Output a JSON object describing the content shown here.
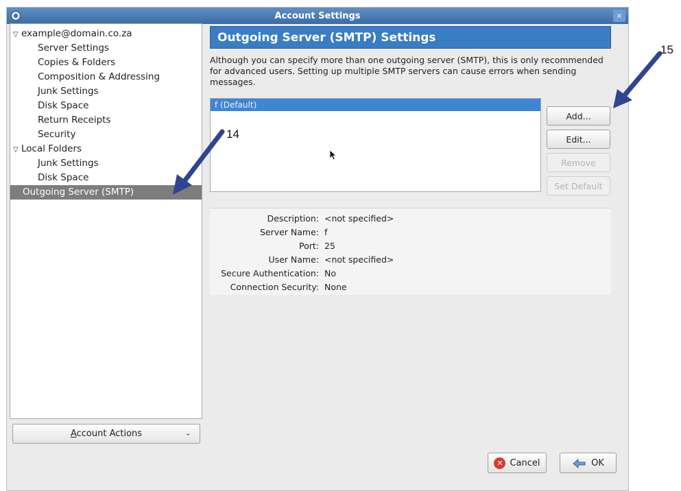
{
  "dialog": {
    "title": "Account Settings",
    "close_glyph": "✕",
    "icon": "app-icon"
  },
  "tree": {
    "items": [
      {
        "label": "example@domain.co.za",
        "twisty": "▽"
      },
      {
        "label": "Server Settings"
      },
      {
        "label": "Copies & Folders"
      },
      {
        "label": "Composition & Addressing"
      },
      {
        "label": "Junk Settings"
      },
      {
        "label": "Disk Space"
      },
      {
        "label": "Return Receipts"
      },
      {
        "label": "Security"
      },
      {
        "label": "Local Folders",
        "twisty": "▽"
      },
      {
        "label": "Junk Settings"
      },
      {
        "label": "Disk Space"
      },
      {
        "label": "Outgoing Server (SMTP)",
        "selected": true
      }
    ]
  },
  "account_actions": {
    "label": "Account Actions",
    "chevron": "⌄"
  },
  "panel": {
    "title": "Outgoing Server (SMTP) Settings",
    "description": "Although you can specify more than one outgoing server (SMTP), this is only recommended for advanced users. Setting up multiple SMTP servers can cause errors when sending messages."
  },
  "server_list": {
    "items": [
      "f (Default)"
    ]
  },
  "buttons": {
    "add": "Add...",
    "edit": "Edit...",
    "remove": "Remove",
    "set_default": "Set Default"
  },
  "details": {
    "rows": [
      {
        "key": "Description:",
        "value": "<not specified>"
      },
      {
        "key": "Server Name:",
        "value": "f"
      },
      {
        "key": "Port:",
        "value": "25"
      },
      {
        "key": "User Name:",
        "value": "<not specified>"
      },
      {
        "key": "Secure Authentication:",
        "value": "No"
      },
      {
        "key": "Connection Security:",
        "value": "None"
      }
    ]
  },
  "footer": {
    "cancel": "Cancel",
    "ok": "OK"
  },
  "annotations": {
    "callout_14": "14",
    "callout_15": "15",
    "arrow_color": "#2f4590"
  },
  "colors": {
    "header_bg": "#3a7dc4",
    "selection_bg": "#3f85d4",
    "tree_selection_bg": "#7d7d7d",
    "cancel_icon": "#d93a2e"
  }
}
